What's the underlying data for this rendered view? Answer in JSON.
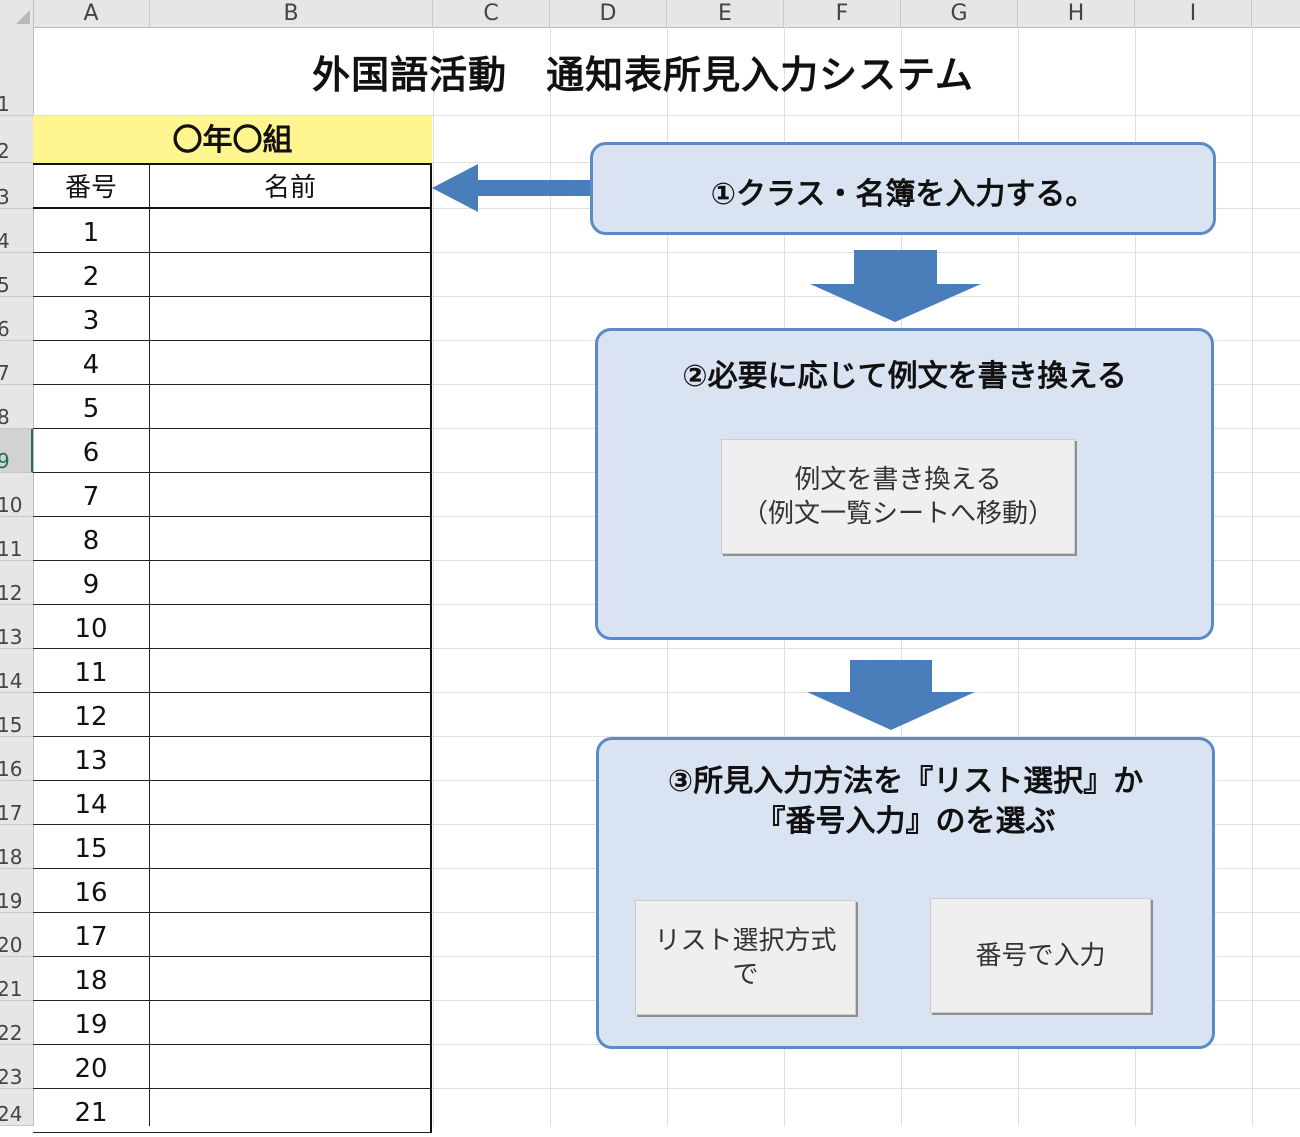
{
  "spreadsheet": {
    "columns": [
      "A",
      "B",
      "C",
      "D",
      "E",
      "F",
      "G",
      "H",
      "I"
    ],
    "rows": [
      "1",
      "2",
      "3",
      "4",
      "5",
      "6",
      "7",
      "8",
      "9",
      "10",
      "11",
      "12",
      "13",
      "14",
      "15",
      "16",
      "17",
      "18",
      "19",
      "20",
      "21",
      "22",
      "23",
      "24"
    ],
    "active_row": "9"
  },
  "title": "外国語活動　通知表所見入力システム",
  "roster": {
    "class_label": "〇年〇組",
    "headers": {
      "number": "番号",
      "name": "名前"
    },
    "numbers": [
      "1",
      "2",
      "3",
      "4",
      "5",
      "6",
      "7",
      "8",
      "9",
      "10",
      "11",
      "12",
      "13",
      "14",
      "15",
      "16",
      "17",
      "18",
      "19",
      "20",
      "21"
    ]
  },
  "steps": {
    "step1": {
      "text": "①クラス・名簿を入力する。"
    },
    "step2": {
      "text": "②必要に応じて例文を書き換える",
      "button_line1": "例文を書き換える",
      "button_line2": "（例文一覧シートへ移動）"
    },
    "step3": {
      "text_line1": "③所見入力方法を『リスト選択』か",
      "text_line2": "『番号入力』のを選ぶ",
      "list_button_line1": "リスト選択方式",
      "list_button_line2": "で",
      "number_button": "番号で入力"
    }
  },
  "colors": {
    "class_header_fill": "#fff58f",
    "box_fill": "#dae3f1",
    "box_border": "#5b8ac7",
    "arrow_fill": "#4a7ebb",
    "active_row_accent": "#217346"
  }
}
